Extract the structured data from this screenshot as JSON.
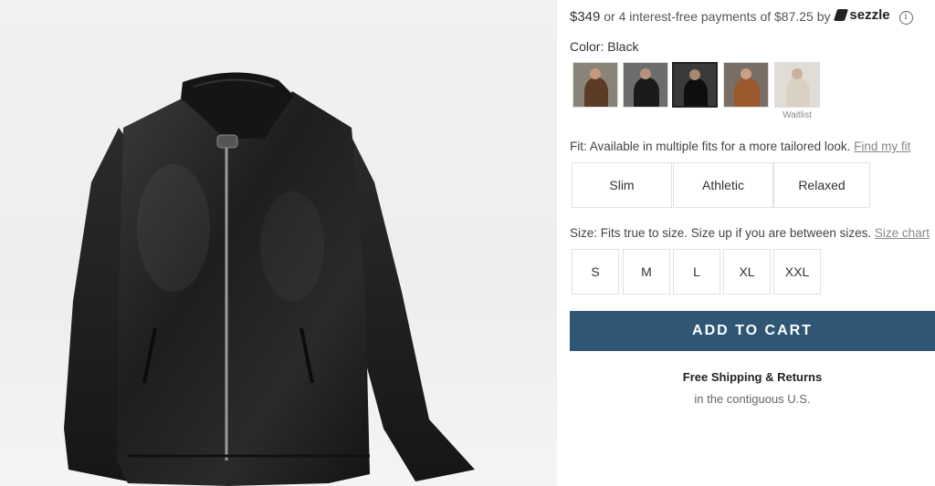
{
  "pricing": {
    "price": "$349",
    "installments_text": "or 4 interest-free payments of $87.25 by",
    "provider": "sezzle",
    "info_icon": "i"
  },
  "color": {
    "label": "Color: Black",
    "swatches": [
      {
        "name": "Brown",
        "selected": false
      },
      {
        "name": "Black variant",
        "selected": false
      },
      {
        "name": "Black",
        "selected": true
      },
      {
        "name": "Cognac",
        "selected": false
      },
      {
        "name": "Cream",
        "selected": false,
        "note": "Waitlist"
      }
    ]
  },
  "fit": {
    "label": "Fit: Available in multiple fits for a more tailored look.",
    "link": "Find my fit",
    "options": [
      "Slim",
      "Athletic",
      "Relaxed"
    ]
  },
  "size": {
    "label": "Size: Fits true to size. Size up if you are between sizes.",
    "link": "Size chart",
    "options": [
      "S",
      "M",
      "L",
      "XL",
      "XXL"
    ]
  },
  "cart": {
    "button_label": "ADD TO CART"
  },
  "shipping": {
    "title": "Free Shipping & Returns",
    "subtitle": "in the contiguous U.S."
  },
  "colors": {
    "accent": "#2f5775",
    "jacket": "#1c1c1c"
  }
}
